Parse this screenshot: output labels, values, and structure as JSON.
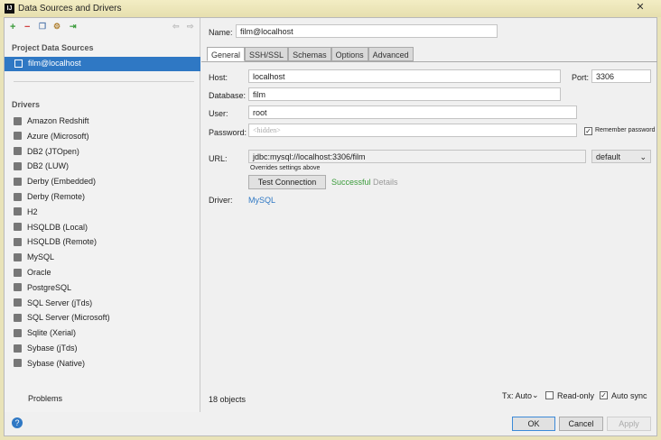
{
  "window": {
    "title": "Data Sources and Drivers",
    "close": "✕",
    "app_icon": "IJ"
  },
  "sidebar": {
    "section_project": "Project Data Sources",
    "selected": "film@localhost",
    "section_drivers": "Drivers",
    "drivers": [
      "Amazon Redshift",
      "Azure (Microsoft)",
      "DB2 (JTOpen)",
      "DB2 (LUW)",
      "Derby (Embedded)",
      "Derby (Remote)",
      "H2",
      "HSQLDB (Local)",
      "HSQLDB (Remote)",
      "MySQL",
      "Oracle",
      "PostgreSQL",
      "SQL Server (jTds)",
      "SQL Server (Microsoft)",
      "Sqlite (Xerial)",
      "Sybase (jTds)",
      "Sybase (Native)"
    ],
    "problems": "Problems"
  },
  "form": {
    "name_label": "Name:",
    "name": "film@localhost",
    "tabs": [
      "General",
      "SSH/SSL",
      "Schemas",
      "Options",
      "Advanced"
    ],
    "host_label": "Host:",
    "host": "localhost",
    "port_label": "Port:",
    "port": "3306",
    "database_label": "Database:",
    "database": "film",
    "user_label": "User:",
    "user": "root",
    "password_label": "Password:",
    "password_placeholder": "<hidden>",
    "remember_label": "Remember password",
    "url_label": "URL:",
    "url": "jdbc:mysql://localhost:3306/film",
    "url_mode": "default",
    "url_hint": "Overrides settings above",
    "test_button": "Test Connection",
    "test_status": "Successful",
    "details": "Details",
    "driver_label": "Driver:",
    "driver": "MySQL",
    "objects": "18 objects",
    "tx": "Tx: Auto",
    "readonly": "Read-only",
    "autosync": "Auto sync"
  },
  "buttons": {
    "ok": "OK",
    "cancel": "Cancel",
    "apply": "Apply",
    "help": "?"
  }
}
